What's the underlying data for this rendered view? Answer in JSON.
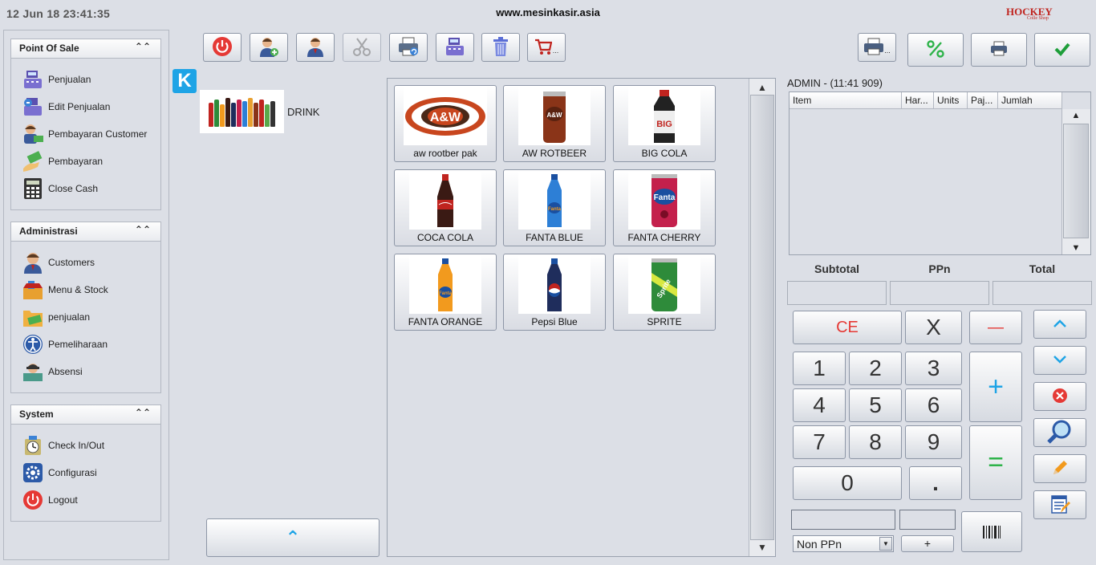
{
  "header": {
    "datetime": "12 Jun 18  23:41:35",
    "site": "www.mesinkasir.asia",
    "brand": "HOCKEY",
    "brand_sub": "Colle Shop"
  },
  "sidebar": {
    "sections": [
      {
        "title": "Point Of Sale",
        "items": [
          {
            "label": "Penjualan",
            "icon": "cash-register-icon"
          },
          {
            "label": "Edit Penjualan",
            "icon": "edit-register-icon"
          },
          {
            "label": "Pembayaran Customer",
            "icon": "customer-payment-icon"
          },
          {
            "label": "Pembayaran",
            "icon": "payment-icon"
          },
          {
            "label": "Close Cash",
            "icon": "calculator-icon"
          }
        ]
      },
      {
        "title": "Administrasi",
        "items": [
          {
            "label": "Customers",
            "icon": "customer-icon"
          },
          {
            "label": "Menu & Stock",
            "icon": "stock-icon"
          },
          {
            "label": "penjualan",
            "icon": "money-folder-icon"
          },
          {
            "label": "Pemeliharaan",
            "icon": "accessibility-icon"
          },
          {
            "label": "Absensi",
            "icon": "attendance-icon"
          }
        ]
      },
      {
        "title": "System",
        "items": [
          {
            "label": "Check In/Out",
            "icon": "clock-icon"
          },
          {
            "label": "Configurasi",
            "icon": "gear-icon"
          },
          {
            "label": "Logout",
            "icon": "power-icon"
          }
        ]
      }
    ]
  },
  "toolbar": {
    "buttons": [
      {
        "name": "power-button",
        "icon": "power-icon"
      },
      {
        "name": "add-customer-button",
        "icon": "add-user-icon"
      },
      {
        "name": "customer-button",
        "icon": "user-icon"
      },
      {
        "name": "split-button",
        "icon": "scissors-icon",
        "disabled": true
      },
      {
        "name": "reprint-button",
        "icon": "printer-refresh-icon"
      },
      {
        "name": "cash-drawer-button",
        "icon": "cash-register-icon"
      },
      {
        "name": "delete-button",
        "icon": "trash-icon"
      },
      {
        "name": "cart-button",
        "icon": "cart-icon",
        "suffix": "..."
      }
    ],
    "right_buttons": [
      {
        "name": "print-options-button",
        "icon": "printer-icon",
        "suffix": "..."
      },
      {
        "name": "discount-button",
        "icon": "percent-icon"
      },
      {
        "name": "print-button",
        "icon": "printer-icon"
      },
      {
        "name": "confirm-button",
        "icon": "check-icon"
      }
    ]
  },
  "category": {
    "label": "DRINK",
    "k_label": "K"
  },
  "products": [
    {
      "label": "aw rootber pak",
      "color": "#c8461e"
    },
    {
      "label": "AW ROTBEER",
      "color": "#8a3418"
    },
    {
      "label": "BIG COLA",
      "color": "#222222"
    },
    {
      "label": "COCA COLA",
      "color": "#3a1a14"
    },
    {
      "label": "FANTA BLUE",
      "color": "#2d7fd6"
    },
    {
      "label": "FANTA CHERRY",
      "color": "#c4204c"
    },
    {
      "label": "FANTA ORANGE",
      "color": "#f29a1e"
    },
    {
      "label": "Pepsi Blue",
      "color": "#1f2d5c"
    },
    {
      "label": "SPRITE",
      "color": "#2e8b3a"
    }
  ],
  "order": {
    "title": "ADMIN - (11:41 909)",
    "columns": [
      "Item",
      "Har...",
      "Units",
      "Paj...",
      "Jumlah"
    ]
  },
  "totals": {
    "subtotal_label": "Subtotal",
    "ppn_label": "PPn",
    "total_label": "Total"
  },
  "keypad": {
    "ce": "CE",
    "multiply": "X",
    "minus": "—",
    "plus": "+",
    "equals": "=",
    "dot": ".",
    "digits": [
      "1",
      "2",
      "3",
      "4",
      "5",
      "6",
      "7",
      "8",
      "9",
      "0"
    ]
  },
  "tax_select": {
    "value": "Non PPn"
  },
  "small_plus": "+"
}
